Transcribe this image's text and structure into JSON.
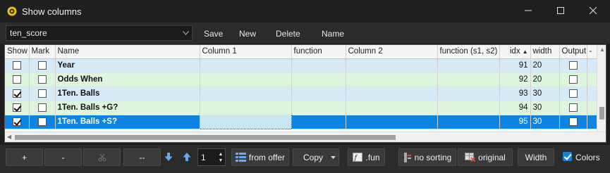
{
  "window": {
    "title": "Show columns",
    "app_icon": "yellow-badge-icon"
  },
  "toolbar": {
    "preset_value": "ten_score",
    "save_label": "Save",
    "new_label": "New",
    "delete_label": "Delete",
    "name_label": "Name"
  },
  "grid": {
    "columns": [
      "Show",
      "Mark",
      "Name",
      "Column 1",
      "function",
      "Column 2",
      "function (s1, s2)",
      "idx",
      "width",
      "Output",
      "-"
    ],
    "rows": [
      {
        "show": false,
        "mark": false,
        "name": "Year",
        "column1": "",
        "function": "",
        "column2": "",
        "function2": "",
        "idx": "91",
        "width": "20",
        "output": false,
        "style": "blue"
      },
      {
        "show": false,
        "mark": false,
        "name": "Odds When",
        "column1": "",
        "function": "",
        "column2": "",
        "function2": "",
        "idx": "92",
        "width": "20",
        "output": false,
        "style": "green"
      },
      {
        "show": true,
        "mark": false,
        "name": "1Ten. Balls",
        "column1": "",
        "function": "",
        "column2": "",
        "function2": "",
        "idx": "93",
        "width": "30",
        "output": false,
        "style": "blue"
      },
      {
        "show": true,
        "mark": false,
        "name": "1Ten. Balls +G?",
        "column1": "",
        "function": "",
        "column2": "",
        "function2": "",
        "idx": "94",
        "width": "30",
        "output": false,
        "style": "green"
      },
      {
        "show": true,
        "mark": false,
        "name": "1Ten. Balls +S?",
        "column1": "",
        "function": "",
        "column2": "",
        "function2": "",
        "idx": "95",
        "width": "30",
        "output": false,
        "style": "selected"
      }
    ],
    "sort_column": "idx",
    "sort_direction": "ascending"
  },
  "bottom": {
    "add_label": "+",
    "remove_label": "-",
    "disabled_icon": "scissors-icon",
    "dash_label": "--",
    "move_down_icon": "arrow-down-icon",
    "move_up_icon": "arrow-up-icon",
    "step_value": "1",
    "from_offer_label": "from offer",
    "copy_label": "Copy",
    "fun_label": ".fun",
    "no_sorting_label": "no sorting",
    "original_label": "original",
    "width_label": "Width",
    "colors_label": "Colors",
    "colors_checked": true
  },
  "colors": {
    "row_blue": "#d6eaf7",
    "row_green": "#dcf5dc",
    "row_selected": "#0d84e3",
    "accent": "#1a7fd8"
  }
}
